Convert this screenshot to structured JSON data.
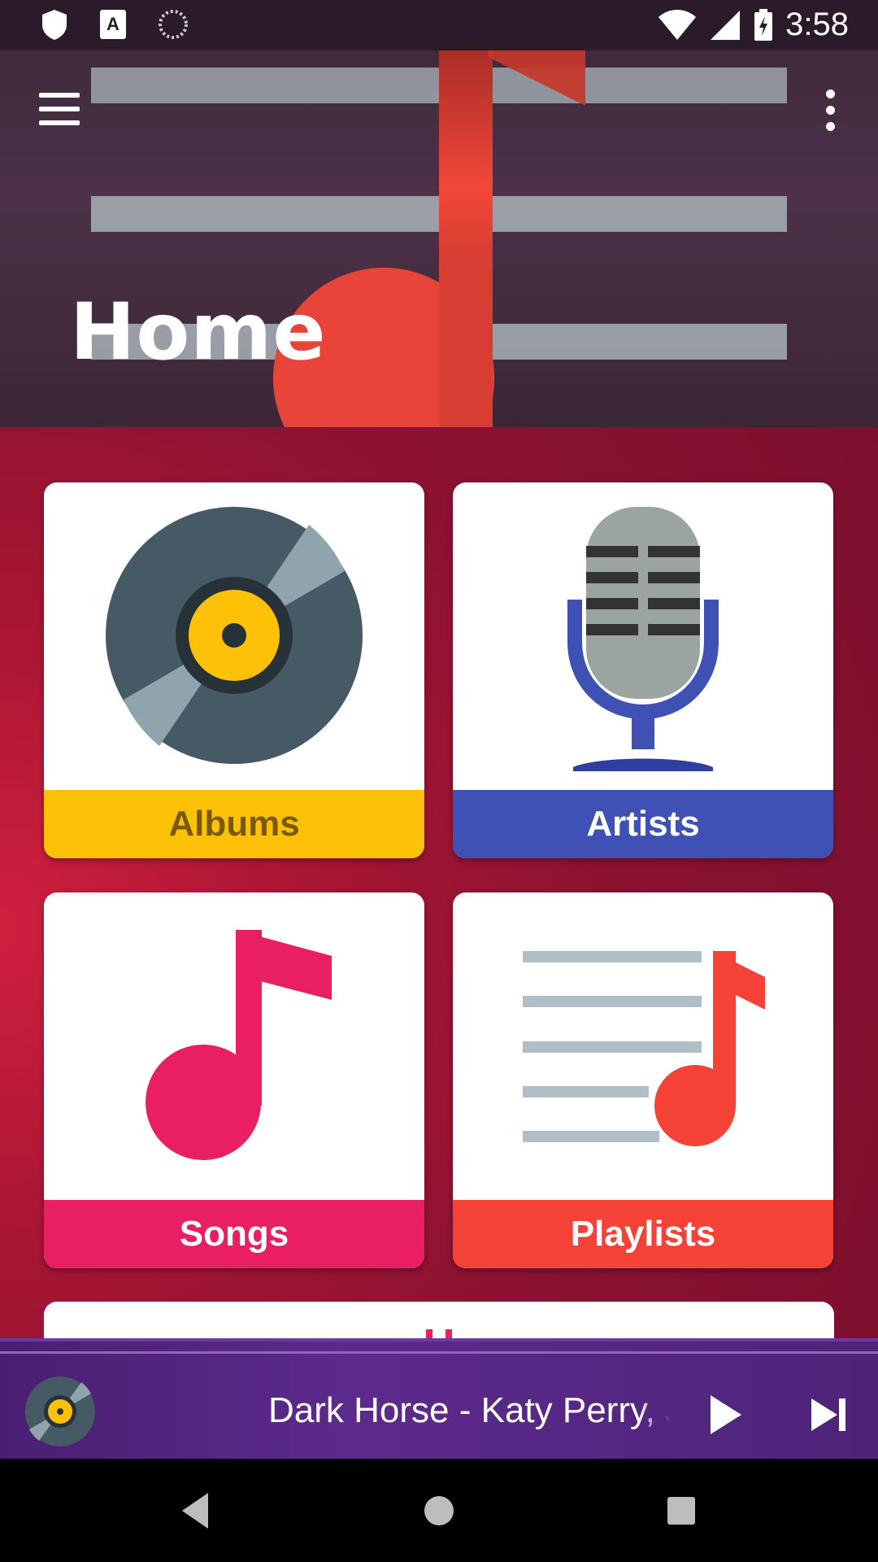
{
  "status_bar": {
    "time": "3:58",
    "icons": [
      "shield-icon",
      "text-a-icon",
      "loading-icon",
      "wifi-icon",
      "signal-icon",
      "battery-charging-icon"
    ]
  },
  "header": {
    "title": "Home",
    "menu_icon": "hamburger-menu-icon",
    "overflow_icon": "more-vert-icon"
  },
  "tiles": [
    {
      "label": "Albums",
      "icon": "vinyl-record-icon",
      "bar_color": "#FFC107",
      "text_color": "#7a5a00"
    },
    {
      "label": "Artists",
      "icon": "microphone-icon",
      "bar_color": "#3F51B5",
      "text_color": "#ffffff"
    },
    {
      "label": "Songs",
      "icon": "music-note-icon",
      "bar_color": "#E91E63",
      "text_color": "#ffffff"
    },
    {
      "label": "Playlists",
      "icon": "playlist-music-icon",
      "bar_color": "#F44336",
      "text_color": "#ffffff"
    }
  ],
  "player": {
    "now_playing": "Dark Horse - Katy Perry, Juicy J",
    "art_icon": "vinyl-record-icon",
    "play_icon": "play-icon",
    "next_icon": "skip-next-icon"
  },
  "navbar": {
    "icons": [
      "back-icon",
      "home-icon",
      "recents-icon"
    ]
  }
}
